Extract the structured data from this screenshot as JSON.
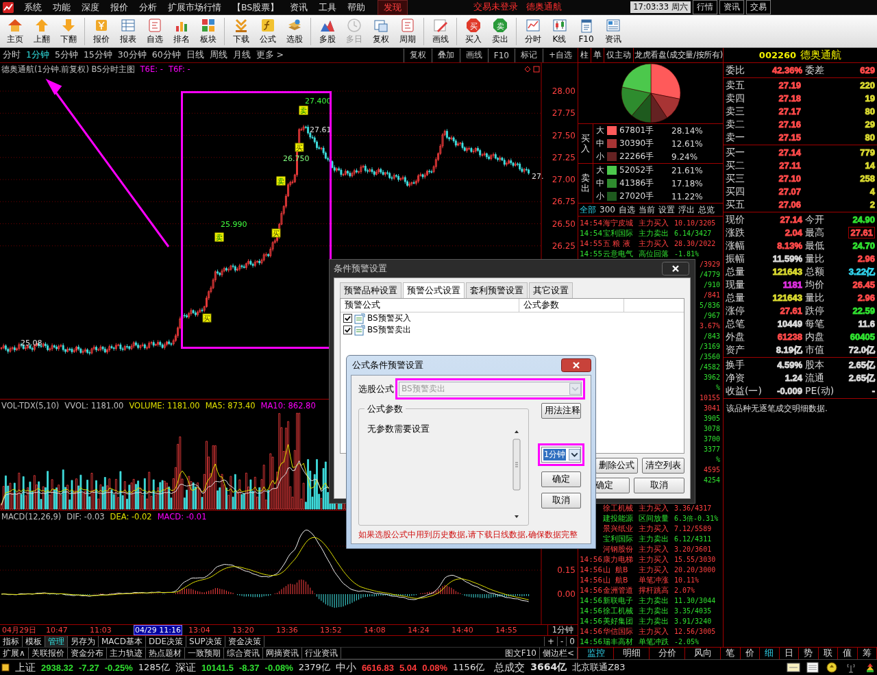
{
  "menu": {
    "items": [
      {
        "label": "系统",
        "selected": false
      },
      {
        "label": "功能",
        "selected": false
      },
      {
        "label": "深度",
        "selected": false
      },
      {
        "label": "报价",
        "selected": false
      },
      {
        "label": "分析",
        "selected": false
      },
      {
        "label": "扩展市场行情",
        "selected": false
      },
      {
        "label": "【BS股票】",
        "selected": false
      },
      {
        "label": "资讯",
        "selected": false
      },
      {
        "label": "工具",
        "selected": false
      },
      {
        "label": "帮助",
        "selected": false
      },
      {
        "label": "发现",
        "selected": true
      }
    ],
    "login_status": "交易未登录",
    "stock_name": "德奥通航",
    "clock": "17:03:33",
    "weekday": "周六",
    "quick_tabs": [
      "行情",
      "资讯",
      "交易"
    ]
  },
  "toolbar": {
    "groups": [
      [
        {
          "label": "主页",
          "kind": "home",
          "disabled": false
        },
        {
          "label": "上翻",
          "kind": "up",
          "disabled": false
        },
        {
          "label": "下翻",
          "kind": "down",
          "disabled": false
        }
      ],
      [
        {
          "label": "报价",
          "kind": "coin",
          "disabled": false
        },
        {
          "label": "报表",
          "kind": "table",
          "disabled": false
        },
        {
          "label": "自选",
          "kind": "key",
          "disabled": false
        },
        {
          "label": "排名",
          "kind": "rank",
          "disabled": false
        },
        {
          "label": "板块",
          "kind": "blocks",
          "disabled": false
        }
      ],
      [
        {
          "label": "下载",
          "kind": "download",
          "disabled": false
        },
        {
          "label": "公式",
          "kind": "formula",
          "disabled": false
        },
        {
          "label": "选股",
          "kind": "stack",
          "disabled": false
        }
      ],
      [
        {
          "label": "多股",
          "kind": "mountain",
          "disabled": false
        },
        {
          "label": "多日",
          "kind": "clock",
          "disabled": true
        },
        {
          "label": "复权",
          "kind": "restore",
          "disabled": false
        },
        {
          "label": "周期",
          "kind": "key",
          "disabled": false
        }
      ],
      [
        {
          "label": "画线",
          "kind": "pencil",
          "disabled": false
        }
      ],
      [
        {
          "label": "买入",
          "kind": "buy",
          "glyph": "买",
          "disabled": false
        },
        {
          "label": "卖出",
          "kind": "sell",
          "glyph": "卖",
          "disabled": false
        }
      ],
      [
        {
          "label": "分时",
          "kind": "line",
          "disabled": false
        },
        {
          "label": "K线",
          "kind": "candle",
          "disabled": false
        },
        {
          "label": "F10",
          "kind": "doc",
          "disabled": false
        },
        {
          "label": "资讯",
          "kind": "news",
          "disabled": false
        }
      ]
    ]
  },
  "period_bar": {
    "periods": [
      {
        "label": "分时",
        "selected": false
      },
      {
        "label": "1分钟",
        "selected": true
      },
      {
        "label": "5分钟",
        "selected": false
      },
      {
        "label": "15分钟",
        "selected": false
      },
      {
        "label": "30分钟",
        "selected": false
      },
      {
        "label": "60分钟",
        "selected": false
      },
      {
        "label": "日线",
        "selected": false
      },
      {
        "label": "周线",
        "selected": false
      },
      {
        "label": "月线",
        "selected": false
      },
      {
        "label": "更多 >",
        "selected": false
      }
    ],
    "tools": [
      "复权",
      "叠加",
      "画线",
      "F10",
      "标记",
      "+自选"
    ]
  },
  "main_chart": {
    "legend": [
      {
        "text": "德奥通航(1分钟.前复权) BS分时主图",
        "color": "#c0c0c0"
      },
      {
        "text": "T6E: -",
        "color": "#ff00ff"
      },
      {
        "text": "T6F: -",
        "color": "#ff00ff"
      }
    ],
    "price_ticks": [
      "28.00",
      "27.75",
      "27.50",
      "27.25",
      "27.00",
      "26.75",
      "26.50",
      "26.25"
    ],
    "price_notes": [
      "27.400",
      "27.61",
      "26.750",
      "25.990",
      "25.08",
      "27."
    ],
    "signals": [
      {
        "kind": "sell",
        "label": "卖"
      },
      {
        "kind": "buy",
        "label": "买"
      },
      {
        "kind": "sell",
        "label": "卖"
      },
      {
        "kind": "buy",
        "label": "买"
      },
      {
        "kind": "sell",
        "label": "卖"
      },
      {
        "kind": "buy",
        "label": "买"
      }
    ]
  },
  "volume_chart": {
    "legend": [
      {
        "text": "VOL-TDX(5,10)",
        "color": "#c0c0c0"
      },
      {
        "text": "VVOL: 1181.00",
        "color": "#c0c0c0"
      },
      {
        "text": "VOLUME: 1181.00",
        "color": "#e0e000"
      },
      {
        "text": "MA5: 873.40",
        "color": "#e0e000"
      },
      {
        "text": "MA10: 862.80",
        "color": "#ff00ff"
      }
    ]
  },
  "macd_chart": {
    "legend": [
      {
        "text": "MACD(12,26,9)",
        "color": "#c0c0c0"
      },
      {
        "text": "DIF: -0.03",
        "color": "#c0c0c0"
      },
      {
        "text": "DEA: -0.02",
        "color": "#e0e000"
      },
      {
        "text": "MACD: -0.01",
        "color": "#ff00ff"
      }
    ],
    "ticks": [
      "0.15",
      "0.00"
    ]
  },
  "time_axis": {
    "labels": [
      {
        "text": "04月29日",
        "kind": "tick"
      },
      {
        "text": "10:47",
        "kind": "tick"
      },
      {
        "text": "11:03",
        "kind": "tick"
      },
      {
        "text": "04/29 11:16",
        "kind": "cursor"
      },
      {
        "text": "13:04",
        "kind": "tick"
      },
      {
        "text": "13:20",
        "kind": "tick"
      },
      {
        "text": "13:36",
        "kind": "tick"
      },
      {
        "text": "13:52",
        "kind": "tick"
      },
      {
        "text": "14:08",
        "kind": "tick"
      },
      {
        "text": "14:24",
        "kind": "tick"
      },
      {
        "text": "14:40",
        "kind": "tick"
      },
      {
        "text": "14:55",
        "kind": "tick"
      }
    ],
    "period": "1分钟"
  },
  "bottom_tabs": {
    "row1": [
      {
        "label": "指标",
        "selected": false
      },
      {
        "label": "模板",
        "selected": false
      },
      {
        "label": "管理",
        "selected": true
      },
      {
        "label": "另存为",
        "selected": false
      },
      {
        "label": "MACD基本",
        "selected": false
      },
      {
        "label": "DDE决策",
        "selected": false
      },
      {
        "label": "SUP决策",
        "selected": false
      },
      {
        "label": "资金决策",
        "selected": false
      }
    ],
    "row1_tools": [
      "+",
      "-",
      "0"
    ],
    "row2": [
      "扩展∧",
      "关联报价",
      "资金分布",
      "主力轨迹",
      "热点题材",
      "一致预期",
      "综合资讯",
      "网摘资讯",
      "行业资讯"
    ],
    "row2_tools": [
      "图文F10",
      "侧边栏<"
    ]
  },
  "dragon_tiger": {
    "tabs": [
      "柱",
      "单",
      "仅主动",
      "龙虎看盘(成交量/按所有)"
    ],
    "groups": [
      {
        "side": "买入",
        "rows": [
          {
            "size": "大",
            "color": "#ff5a5a",
            "volume": "67801手",
            "pct": "28.14%"
          },
          {
            "size": "中",
            "color": "#a83434",
            "volume": "30390手",
            "pct": "12.61%"
          },
          {
            "size": "小",
            "color": "#642222",
            "volume": "22266手",
            "pct": "9.24%"
          }
        ]
      },
      {
        "side": "卖出",
        "rows": [
          {
            "size": "大",
            "color": "#4cc84c",
            "volume": "52052手",
            "pct": "21.61%"
          },
          {
            "size": "中",
            "color": "#2e8c2e",
            "volume": "41386手",
            "pct": "17.18%"
          },
          {
            "size": "小",
            "color": "#1e5a1e",
            "volume": "27020手",
            "pct": "11.22%"
          }
        ]
      }
    ],
    "filters": [
      {
        "label": "全部",
        "selected": true
      },
      {
        "label": "300",
        "selected": false
      },
      {
        "label": "自选",
        "selected": false
      },
      {
        "label": "当前",
        "selected": false
      },
      {
        "label": "设置",
        "selected": false
      },
      {
        "label": "浮出",
        "selected": false
      },
      {
        "label": "总览",
        "selected": false
      }
    ]
  },
  "alerts": {
    "top": [
      {
        "time": "14:54",
        "name": "海宁皮城",
        "event": "主力买入",
        "value": "10.10/3205",
        "kind": "up"
      },
      {
        "time": "14:54",
        "name": "宝利国际",
        "event": "主力卖出",
        "value": "6.14/3427",
        "kind": "down"
      },
      {
        "time": "14:55",
        "name": "五 粮 液",
        "event": "主力买入",
        "value": "28.30/2022",
        "kind": "up"
      },
      {
        "time": "14:55",
        "name": "云意电气",
        "event": "高位回落",
        "value": "-1.81%",
        "kind": "down"
      }
    ],
    "covered": [
      {
        "value": "/3929",
        "kind": "up"
      },
      {
        "value": "/4779",
        "kind": "down"
      },
      {
        "value": "/910",
        "kind": "down"
      },
      {
        "value": "/841",
        "kind": "up"
      },
      {
        "value": "5/836",
        "kind": "down"
      },
      {
        "value": "/967",
        "kind": "down"
      },
      {
        "value": "3.67%",
        "kind": "up"
      },
      {
        "value": "/843",
        "kind": "down"
      },
      {
        "value": "/3169",
        "kind": "down"
      },
      {
        "value": "/3560",
        "kind": "down"
      },
      {
        "value": "/4582",
        "kind": "down"
      },
      {
        "value": "3962",
        "kind": "down"
      },
      {
        "value": "%",
        "kind": "down"
      },
      {
        "value": "10155",
        "kind": "up"
      },
      {
        "value": "3041",
        "kind": "up"
      },
      {
        "value": "3905",
        "kind": "down"
      },
      {
        "value": "3078",
        "kind": "down"
      },
      {
        "value": "3700",
        "kind": "down"
      },
      {
        "value": "3377",
        "kind": "down"
      },
      {
        "value": "%",
        "kind": "down"
      },
      {
        "value": "4595",
        "kind": "up"
      },
      {
        "value": "4254",
        "kind": "down"
      }
    ],
    "lower": [
      {
        "name": "徐工机械",
        "event": "主力买入",
        "value": "3.36/4317",
        "kind": "up"
      },
      {
        "name": "建投能源",
        "event": "区间放量",
        "value": "6.3倍-0.31%",
        "kind": "down"
      },
      {
        "name": "景兴纸业",
        "event": "主力买入",
        "value": "7.12/5589",
        "kind": "up"
      },
      {
        "name": "宝利国际",
        "event": "主力卖出",
        "value": "6.12/4311",
        "kind": "down"
      },
      {
        "name": "河钢股份",
        "event": "主力买入",
        "value": "3.20/3601",
        "kind": "up"
      },
      {
        "time": "14:56",
        "name": "康力电梯",
        "event": "主力买入",
        "value": "15.55/3030",
        "kind": "up"
      },
      {
        "time": "14:56",
        "name": "山  航B",
        "event": "主力买入",
        "value": "20.20/3000",
        "kind": "up"
      },
      {
        "time": "14:56",
        "name": "山  航B",
        "event": "单笔冲涨",
        "value": "10.11%",
        "kind": "up"
      },
      {
        "time": "14:56",
        "name": "金洲管道",
        "event": "撑杆跳高",
        "value": "2.07%",
        "kind": "up"
      },
      {
        "time": "14:56",
        "name": "新联电子",
        "event": "主力卖出",
        "value": "11.30/3044",
        "kind": "down"
      },
      {
        "time": "14:56",
        "name": "徐工机械",
        "event": "主力卖出",
        "value": "3.35/4035",
        "kind": "down"
      },
      {
        "time": "14:56",
        "name": "美好集团",
        "event": "主力卖出",
        "value": "3.91/3240",
        "kind": "down"
      },
      {
        "time": "14:56",
        "name": "华信国际",
        "event": "主力买入",
        "value": "12.56/3005",
        "kind": "up"
      },
      {
        "time": "14:56",
        "name": "瑞丰高材",
        "event": "单笔冲跌",
        "value": "-2.05%",
        "kind": "down"
      }
    ]
  },
  "quote": {
    "code": "002260",
    "name": "德奥通航",
    "ratio_row": [
      {
        "label": "委比",
        "value": "42.36%",
        "color": "#ff4a4a",
        "boxed": false
      },
      {
        "label": "委差",
        "value": "629",
        "color": "#ff4a4a",
        "boxed": false
      }
    ],
    "asks": [
      {
        "label": "卖五",
        "price": "27.19",
        "volume": "220"
      },
      {
        "label": "卖四",
        "price": "27.18",
        "volume": "19"
      },
      {
        "label": "卖三",
        "price": "27.17",
        "volume": "80"
      },
      {
        "label": "卖二",
        "price": "27.16",
        "volume": "29"
      },
      {
        "label": "卖一",
        "price": "27.15",
        "volume": "80"
      }
    ],
    "bids": [
      {
        "label": "买一",
        "price": "27.14",
        "volume": "779"
      },
      {
        "label": "买二",
        "price": "27.11",
        "volume": "14"
      },
      {
        "label": "买三",
        "price": "27.10",
        "volume": "258"
      },
      {
        "label": "买四",
        "price": "27.07",
        "volume": "4"
      },
      {
        "label": "买五",
        "price": "27.06",
        "volume": "2"
      }
    ],
    "stats": [
      [
        {
          "label": "现价",
          "value": "27.14",
          "color": "#ff4a4a",
          "boxed": false
        },
        {
          "label": "今开",
          "value": "24.90",
          "color": "#30e030",
          "boxed": false
        }
      ],
      [
        {
          "label": "涨跌",
          "value": "2.04",
          "color": "#ff4a4a",
          "boxed": false
        },
        {
          "label": "最高",
          "value": "27.61",
          "color": "#ff4a4a",
          "boxed": true
        }
      ],
      [
        {
          "label": "涨幅",
          "value": "8.13%",
          "color": "#ff4a4a",
          "boxed": false
        },
        {
          "label": "最低",
          "value": "24.70",
          "color": "#30e030",
          "boxed": false
        }
      ],
      [
        {
          "label": "振幅",
          "value": "11.59%",
          "color": "#d8d8d8",
          "boxed": false
        },
        {
          "label": "量比",
          "value": "2.96",
          "color": "#ff4a4a",
          "boxed": false
        }
      ],
      [
        {
          "label": "总量",
          "value": "121643",
          "color": "#d8d830",
          "boxed": false
        },
        {
          "label": "总额",
          "value": "3.22亿",
          "color": "#30d0e8",
          "boxed": false
        }
      ],
      [
        {
          "label": "现量",
          "value": "1181",
          "color": "#e030e0",
          "boxed": false
        },
        {
          "label": "均价",
          "value": "26.45",
          "color": "#ff4a4a",
          "boxed": false
        }
      ],
      [
        {
          "label": "总量",
          "value": "121643",
          "color": "#d8d830",
          "boxed": false
        },
        {
          "label": "量比",
          "value": "2.96",
          "color": "#ff4a4a",
          "boxed": false
        }
      ],
      [
        {
          "label": "涨停",
          "value": "27.61",
          "color": "#ff4a4a",
          "boxed": false
        },
        {
          "label": "跌停",
          "value": "22.59",
          "color": "#30e030",
          "boxed": false
        }
      ],
      [
        {
          "label": "总笔",
          "value": "10449",
          "color": "#d8d8d8",
          "boxed": false
        },
        {
          "label": "每笔",
          "value": "11.6",
          "color": "#d8d8d8",
          "boxed": false
        }
      ],
      [
        {
          "label": "外盘",
          "value": "61238",
          "color": "#ff4a4a",
          "boxed": false
        },
        {
          "label": "内盘",
          "value": "60405",
          "color": "#30e030",
          "boxed": false
        }
      ],
      [
        {
          "label": "资产",
          "value": "8.19亿",
          "color": "#d8d8d8",
          "boxed": false
        },
        {
          "label": "市值",
          "value": "72.0亿",
          "color": "#d8d8d8",
          "boxed": false
        }
      ]
    ],
    "stats2": [
      [
        {
          "label": "换手",
          "value": "4.59%",
          "color": "#d8d8d8",
          "boxed": false
        },
        {
          "label": "股本",
          "value": "2.65亿",
          "color": "#d8d8d8",
          "boxed": false
        }
      ],
      [
        {
          "label": "净资",
          "value": "1.24",
          "color": "#d8d8d8",
          "boxed": false
        },
        {
          "label": "流通",
          "value": "2.65亿",
          "color": "#d8d8d8",
          "boxed": false
        }
      ],
      [
        {
          "label": "收益(一)",
          "value": "-0.009",
          "color": "#d8d8d8",
          "boxed": false
        },
        {
          "label": "PE(动)",
          "value": "-",
          "color": "#d8d8d8",
          "boxed": false
        }
      ]
    ],
    "note": "该品种无逐笔成交明细数据."
  },
  "right_tabs": {
    "left": [
      {
        "label": "监控",
        "selected": true
      },
      {
        "label": "明细",
        "selected": false
      },
      {
        "label": "分价",
        "selected": false
      },
      {
        "label": "风向",
        "selected": false
      }
    ],
    "right": [
      {
        "label": "笔",
        "selected": false
      },
      {
        "label": "价",
        "selected": false
      },
      {
        "label": "细",
        "selected": true
      },
      {
        "label": "日",
        "selected": false
      },
      {
        "label": "势",
        "selected": false
      },
      {
        "label": "联",
        "selected": false
      },
      {
        "label": "值",
        "selected": false
      },
      {
        "label": "筹",
        "selected": false
      }
    ]
  },
  "status_bar": {
    "indices": [
      {
        "name": "上证",
        "value": "2938.32",
        "change": "-7.27",
        "pct": "-0.25%",
        "amount": "1285亿",
        "color": "#30e030"
      },
      {
        "name": "深证",
        "value": "10141.5",
        "change": "-8.37",
        "pct": "-0.08%",
        "amount": "2379亿",
        "color": "#30e030"
      },
      {
        "name": "中小",
        "value": "6616.83",
        "change": "5.04",
        "pct": "0.08%",
        "amount": "1156亿",
        "color": "#ff3a3a"
      }
    ],
    "total_label": "总成交",
    "total": "3664亿",
    "server": "北京联通Z83"
  },
  "alert_dialog": {
    "title": "条件预警设置",
    "tabs": [
      {
        "label": "预警品种设置",
        "selected": false
      },
      {
        "label": "预警公式设置",
        "selected": true
      },
      {
        "label": "套利预警设置",
        "selected": false
      },
      {
        "label": "其它设置",
        "selected": false
      }
    ],
    "columns": [
      "预警公式",
      "公式参数"
    ],
    "formulas": [
      {
        "name": "BS预警买入",
        "checked": true
      },
      {
        "name": "BS预警卖出",
        "checked": true
      }
    ],
    "buttons": [
      "删除公式",
      "清空列表"
    ],
    "footer_buttons": [
      "确定",
      "取消"
    ]
  },
  "formula_dialog": {
    "title": "公式条件预警设置",
    "formula_label": "选股公式",
    "formula": {
      "value": "BS预警卖出",
      "disabled": true
    },
    "params_title": "公式参数",
    "params_text": "无参数需要设置",
    "help_button": "用法注释",
    "period": {
      "value": "1分钟"
    },
    "buttons": [
      "确定",
      "取消"
    ],
    "note": "如果选股公式中用到历史数据,请下载日线数据,确保数据完整"
  }
}
